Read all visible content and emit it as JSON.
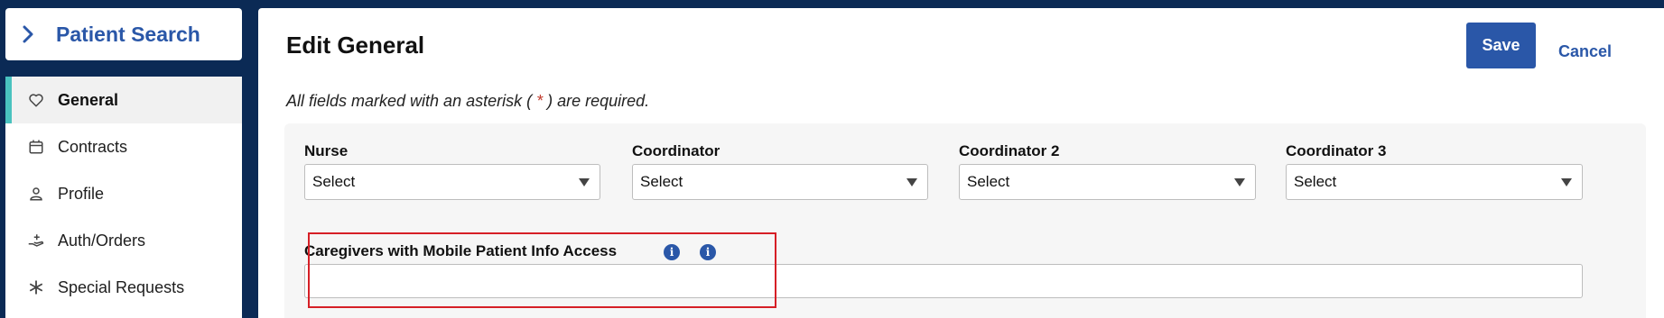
{
  "patient_search": {
    "title": "Patient Search",
    "icon": "chevron-right-icon"
  },
  "sidebar": {
    "items": [
      {
        "label": "General",
        "icon": "heart-icon",
        "active": true
      },
      {
        "label": "Contracts",
        "icon": "calendar-icon",
        "active": false
      },
      {
        "label": "Profile",
        "icon": "person-icon",
        "active": false
      },
      {
        "label": "Auth/Orders",
        "icon": "hand-plus-icon",
        "active": false
      },
      {
        "label": "Special Requests",
        "icon": "asterisk-icon",
        "active": false
      }
    ]
  },
  "header": {
    "title": "Edit General",
    "save_label": "Save",
    "cancel_label": "Cancel"
  },
  "required_note": {
    "before": "All fields marked with an asterisk ( ",
    "star": "*",
    "after": " ) are required."
  },
  "form": {
    "selects": [
      {
        "label": "Nurse",
        "value": "Select"
      },
      {
        "label": "Coordinator",
        "value": "Select"
      },
      {
        "label": "Coordinator 2",
        "value": "Select"
      },
      {
        "label": "Coordinator 3",
        "value": "Select"
      }
    ],
    "caregivers": {
      "label": "Caregivers with Mobile Patient Info Access",
      "value": "",
      "info_icon": "info-icon"
    }
  },
  "colors": {
    "brand_blue": "#2a57a8",
    "active_accent": "#49c2bf",
    "required_star": "#c0392b",
    "highlight": "#d61f26",
    "top_bar": "#0b2a55"
  }
}
